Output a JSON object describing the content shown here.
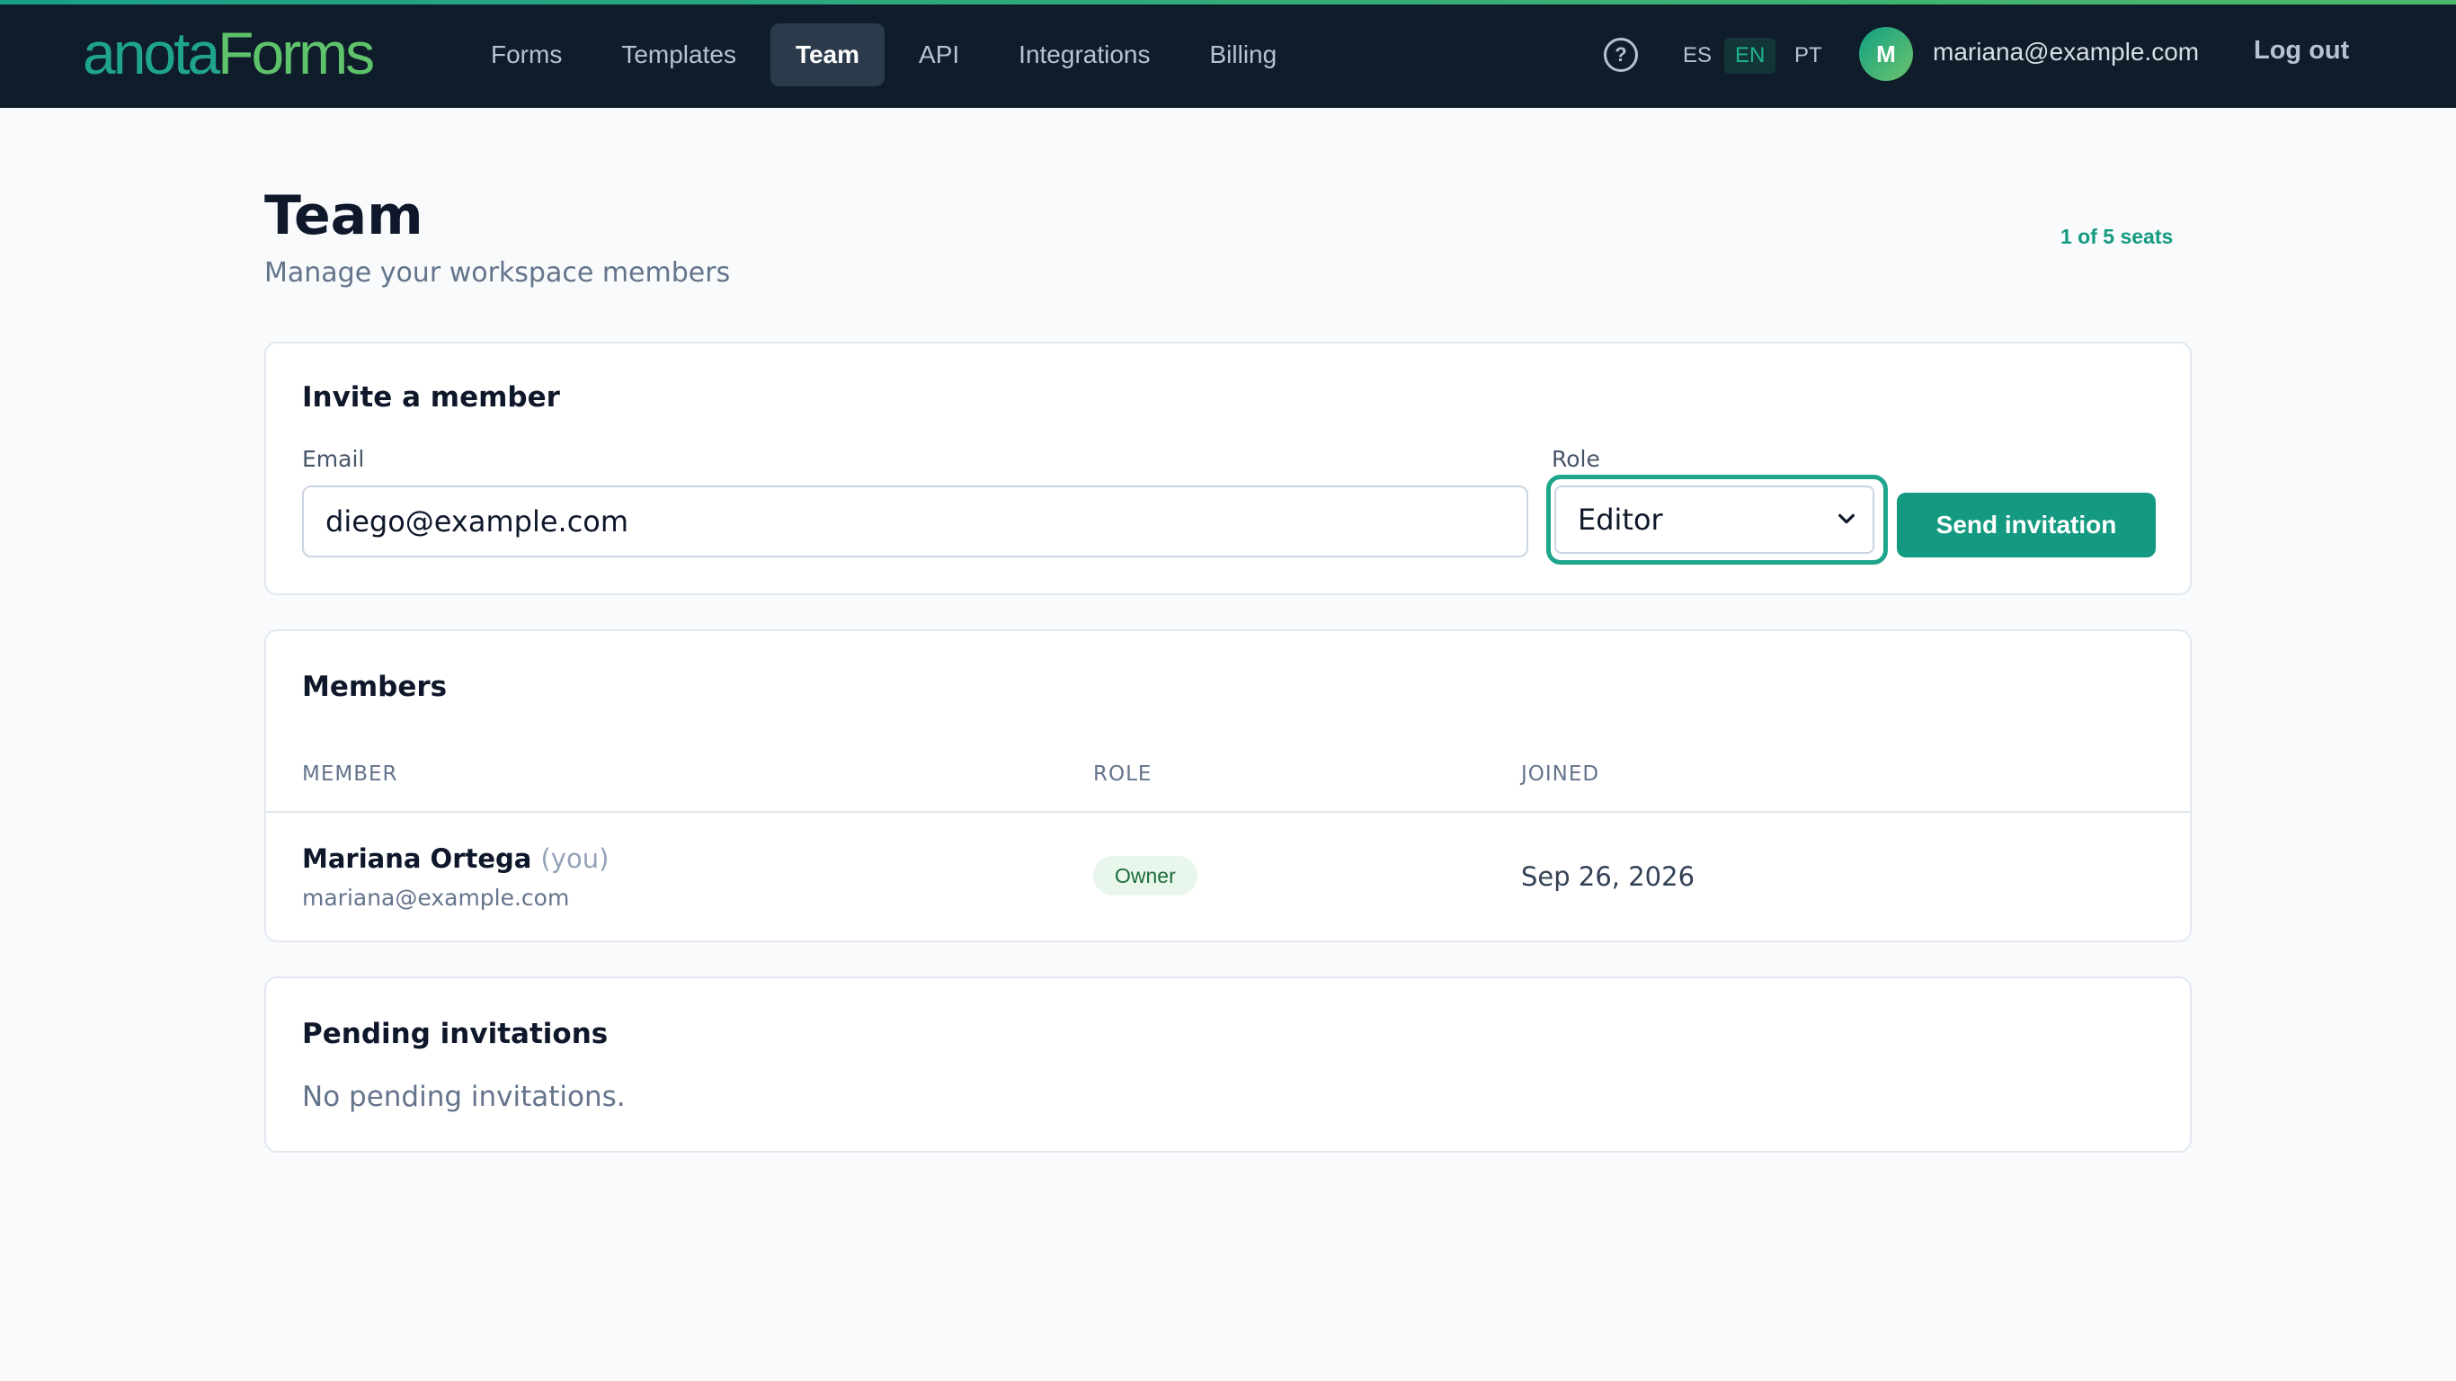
{
  "header": {
    "logo_part1": "anota",
    "logo_part2": "Forms",
    "nav": [
      {
        "label": "Forms",
        "active": false
      },
      {
        "label": "Templates",
        "active": false
      },
      {
        "label": "Team",
        "active": true
      },
      {
        "label": "API",
        "active": false
      },
      {
        "label": "Integrations",
        "active": false
      },
      {
        "label": "Billing",
        "active": false
      }
    ],
    "help_icon": "question-circle-icon",
    "help_glyph": "?",
    "languages": [
      {
        "code": "ES",
        "active": false
      },
      {
        "code": "EN",
        "active": true
      },
      {
        "code": "PT",
        "active": false
      }
    ],
    "avatar_initial": "M",
    "user_email": "mariana@example.com",
    "logout_label": "Log out",
    "accent_colors": [
      "#1fa58c",
      "#5fc36b"
    ]
  },
  "page": {
    "title": "Team",
    "subtitle": "Manage your workspace members",
    "seats": "1 of 5 seats"
  },
  "invite": {
    "title": "Invite a member",
    "email_label": "Email",
    "email_value": "diego@example.com",
    "role_label": "Role",
    "role_value": "Editor",
    "send_label": "Send invitation"
  },
  "members": {
    "title": "Members",
    "columns": [
      "MEMBER",
      "ROLE",
      "JOINED"
    ],
    "rows": [
      {
        "name": "Mariana Ortega",
        "you_tag": "(you)",
        "email": "mariana@example.com",
        "role": "Owner",
        "joined": "Sep 26, 2026"
      }
    ]
  },
  "pending": {
    "title": "Pending invitations",
    "empty_text": "No pending invitations."
  }
}
